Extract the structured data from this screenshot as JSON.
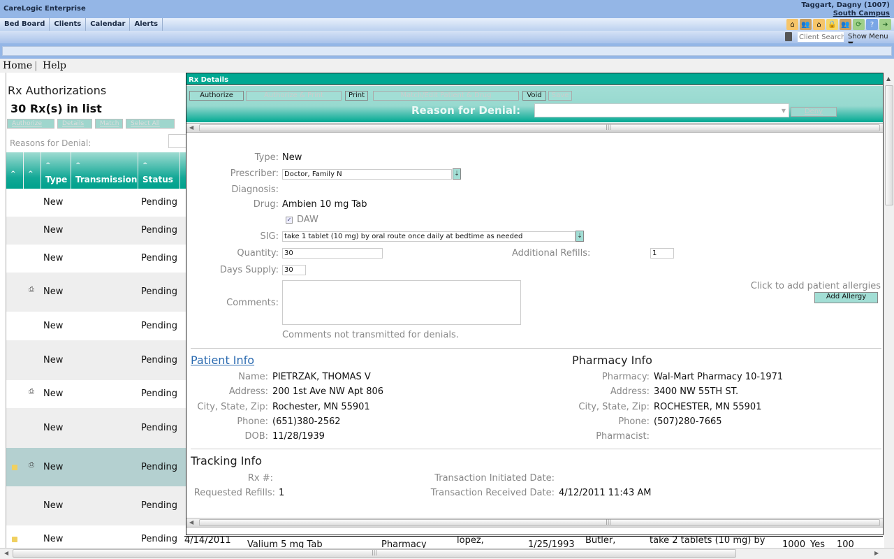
{
  "app": {
    "title": "CareLogic Enterprise",
    "user": "Taggart, Dagny (1007)",
    "campus": "South Campus"
  },
  "nav": {
    "items": [
      {
        "label": "Bed Board"
      },
      {
        "label": "Clients"
      },
      {
        "label": "Calendar"
      },
      {
        "label": "Alerts"
      }
    ]
  },
  "toolbar": {
    "icons": [
      "home-icon",
      "people-icon",
      "home-icon",
      "lock-icon",
      "people-icon",
      "refresh-icon",
      "help-icon",
      "exit-icon"
    ],
    "client_search_placeholder": "Client Search",
    "show_menu": "Show Menu ▼"
  },
  "links": {
    "home": "Home",
    "separator": "|",
    "help": "Help"
  },
  "left_panel": {
    "title": "Rx Authorizations",
    "count": "30 Rx(s) in list",
    "buttons": [
      {
        "label": "Authorize"
      },
      {
        "label": "Details"
      },
      {
        "label": "Match"
      },
      {
        "label": "Select All"
      }
    ],
    "reasons_label": "Reasons for Denial:",
    "columns": [
      "",
      "",
      "Type",
      "Transmission",
      "Status"
    ],
    "rows": [
      {
        "type": "New",
        "status": "Pending",
        "locked": false,
        "print": false,
        "selected": false
      },
      {
        "type": "New",
        "status": "Pending",
        "locked": false,
        "print": false,
        "selected": false
      },
      {
        "type": "New",
        "status": "Pending",
        "locked": false,
        "print": false,
        "selected": false
      },
      {
        "type": "New",
        "status": "Pending",
        "locked": false,
        "print": true,
        "selected": false
      },
      {
        "type": "New",
        "status": "Pending",
        "locked": false,
        "print": false,
        "selected": false
      },
      {
        "type": "New",
        "status": "Pending",
        "locked": false,
        "print": false,
        "selected": false
      },
      {
        "type": "New",
        "status": "Pending",
        "locked": false,
        "print": true,
        "selected": false
      },
      {
        "type": "New",
        "status": "Pending",
        "locked": false,
        "print": false,
        "selected": false
      },
      {
        "type": "New",
        "status": "Pending",
        "locked": true,
        "print": true,
        "selected": true
      },
      {
        "type": "New",
        "status": "Pending",
        "locked": false,
        "print": false,
        "selected": false
      },
      {
        "type": "New",
        "status": "Pending",
        "locked": true,
        "print": false,
        "selected": false
      }
    ],
    "partial_row": {
      "date": "4/14/2011",
      "drug": "Valium 5 mg Tab",
      "transmission": "Pharmacy",
      "patient": "lopez,",
      "dob": "1/25/1993",
      "prescriber": "Butler,",
      "sig": "take 2 tablets (10 mg) by",
      "id": "1000",
      "flag": "Yes",
      "qty": "100"
    }
  },
  "details": {
    "title": "Rx Details",
    "buttons": {
      "authorize": "Authorize",
      "authorize_print": "Authorize & Print",
      "print": "Print",
      "match_edit": "Match/Edit Patient & Drug",
      "void": "Void",
      "save": "Save"
    },
    "reason_label": "Reason for Denial:",
    "reason_value": "",
    "deny": "Deny",
    "form": {
      "type_label": "Type:",
      "type": "New",
      "prescriber_label": "Prescriber:",
      "prescriber": "Doctor, Family N",
      "diagnosis_label": "Diagnosis:",
      "diagnosis": "",
      "drug_label": "Drug:",
      "drug": "Ambien 10 mg Tab",
      "daw_label": "DAW",
      "daw_checked": true,
      "sig_label": "SIG:",
      "sig": "take 1 tablet (10 mg) by oral route once daily at bedtime as needed",
      "quantity_label": "Quantity:",
      "quantity": "30",
      "refills_label": "Additional Refills:",
      "refills": "1",
      "days_supply_label": "Days Supply:",
      "days_supply": "30",
      "comments_label": "Comments:",
      "comments": "",
      "comments_note": "Comments not transmitted for denials.",
      "allergy_hint": "Click to add patient allergies",
      "add_allergy": "Add Allergy"
    },
    "patient": {
      "title": "Patient Info",
      "name_label": "Name:",
      "name": "PIETRZAK, THOMAS V",
      "address_label": "Address:",
      "address": "200 1st Ave NW Apt 806",
      "csz_label": "City, State, Zip:",
      "csz": "Rochester, MN 55901",
      "phone_label": "Phone:",
      "phone": "(651)380-2562",
      "dob_label": "DOB:",
      "dob": "11/28/1939"
    },
    "pharmacy": {
      "title": "Pharmacy Info",
      "pharmacy_label": "Pharmacy:",
      "pharmacy": "Wal-Mart Pharmacy 10-1971",
      "address_label": "Address:",
      "address": "3400 NW 55TH ST.",
      "csz_label": "City, State, Zip:",
      "csz": "ROCHESTER, MN 55901",
      "phone_label": "Phone:",
      "phone": "(507)280-7665",
      "pharmacist_label": "Pharmacist:",
      "pharmacist": ""
    },
    "tracking": {
      "title": "Tracking Info",
      "rx_label": "Rx #:",
      "rx": "",
      "requested_refills_label": "Requested Refills:",
      "requested_refills": "1",
      "initiated_label": "Transaction Initiated Date:",
      "initiated": "",
      "received_label": "Transaction Received Date:",
      "received": "4/12/2011 11:43 AM"
    }
  }
}
